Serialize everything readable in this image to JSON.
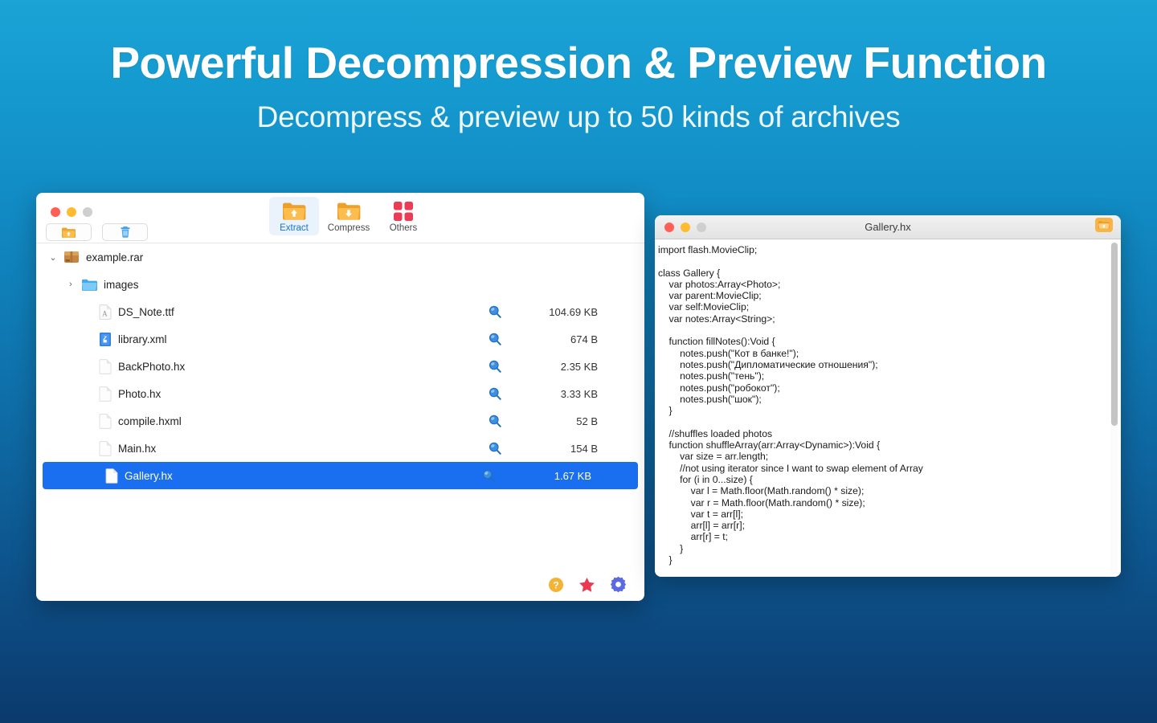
{
  "hero": {
    "title": "Powerful Decompression & Preview Function",
    "subtitle": "Decompress & preview up to 50 kinds of archives"
  },
  "colors": {
    "bg_top": "#1ba3d6",
    "bg_bottom": "#0b3a6d",
    "selection_blue": "#1a6ef0",
    "accent_blue": "#1574d6",
    "folder_orange": "#f5a623",
    "others_red": "#e8334a"
  },
  "archive_window": {
    "traffic_lights": [
      "close",
      "minimize",
      "zoom"
    ],
    "quick_buttons": [
      {
        "name": "extract-quick-button",
        "icon": "extract-folder-icon"
      },
      {
        "name": "delete-quick-button",
        "icon": "trash-icon"
      }
    ],
    "toolbar": [
      {
        "label": "Extract",
        "icon": "extract-folder-icon",
        "active": true
      },
      {
        "label": "Compress",
        "icon": "compress-folder-icon",
        "active": false
      },
      {
        "label": "Others",
        "icon": "grid-squares-icon",
        "active": false
      }
    ],
    "files": [
      {
        "name": "example.rar",
        "icon": "rar-archive-icon",
        "size": "",
        "indent": 0,
        "twisty": "⌄",
        "selected": false,
        "preview": false
      },
      {
        "name": "images",
        "icon": "folder-icon",
        "size": "",
        "indent": 1,
        "twisty": "›",
        "selected": false,
        "preview": false
      },
      {
        "name": "DS_Note.ttf",
        "icon": "font-file-icon",
        "size": "104.69 KB",
        "indent": 2,
        "twisty": "",
        "selected": false,
        "preview": true
      },
      {
        "name": "library.xml",
        "icon": "xml-file-icon",
        "size": "674 B",
        "indent": 2,
        "twisty": "",
        "selected": false,
        "preview": true
      },
      {
        "name": "BackPhoto.hx",
        "icon": "generic-file-icon",
        "size": "2.35 KB",
        "indent": 2,
        "twisty": "",
        "selected": false,
        "preview": true
      },
      {
        "name": "Photo.hx",
        "icon": "generic-file-icon",
        "size": "3.33 KB",
        "indent": 2,
        "twisty": "",
        "selected": false,
        "preview": true
      },
      {
        "name": "compile.hxml",
        "icon": "generic-file-icon",
        "size": "52 B",
        "indent": 2,
        "twisty": "",
        "selected": false,
        "preview": true
      },
      {
        "name": "Main.hx",
        "icon": "generic-file-icon",
        "size": "154 B",
        "indent": 2,
        "twisty": "",
        "selected": false,
        "preview": true
      },
      {
        "name": "Gallery.hx",
        "icon": "generic-file-icon",
        "size": "1.67 KB",
        "indent": 2,
        "twisty": "",
        "selected": true,
        "preview": true
      }
    ],
    "footer_icons": [
      {
        "name": "help-icon",
        "glyph": "?"
      },
      {
        "name": "star-icon",
        "glyph": "★"
      },
      {
        "name": "gear-icon",
        "glyph": "⚙"
      }
    ]
  },
  "code_window": {
    "title": "Gallery.hx",
    "traffic_lights": [
      "close",
      "minimize",
      "zoom"
    ],
    "header_button_icon": "extract-folder-icon",
    "code": "import flash.MovieClip;\n\nclass Gallery {\n    var photos:Array<Photo>;\n    var parent:MovieClip;\n    var self:MovieClip;\n    var notes:Array<String>;\n\n    function fillNotes():Void {\n        notes.push(\"Кот в банке!\");\n        notes.push(\"Дипломатические отношения\");\n        notes.push(\"тень\");\n        notes.push(\"робокот\");\n        notes.push(\"шок\");\n    }\n\n    //shuffles loaded photos\n    function shuffleArray(arr:Array<Dynamic>):Void {\n        var size = arr.length;\n        //not using iterator since I want to swap element of Array\n        for (i in 0...size) {\n            var l = Math.floor(Math.random() * size);\n            var r = Math.floor(Math.random() * size);\n            var t = arr[l];\n            arr[l] = arr[r];\n            arr[r] = t;\n        }\n    }\n\n    public function new(parent:MovieClip) {"
  }
}
